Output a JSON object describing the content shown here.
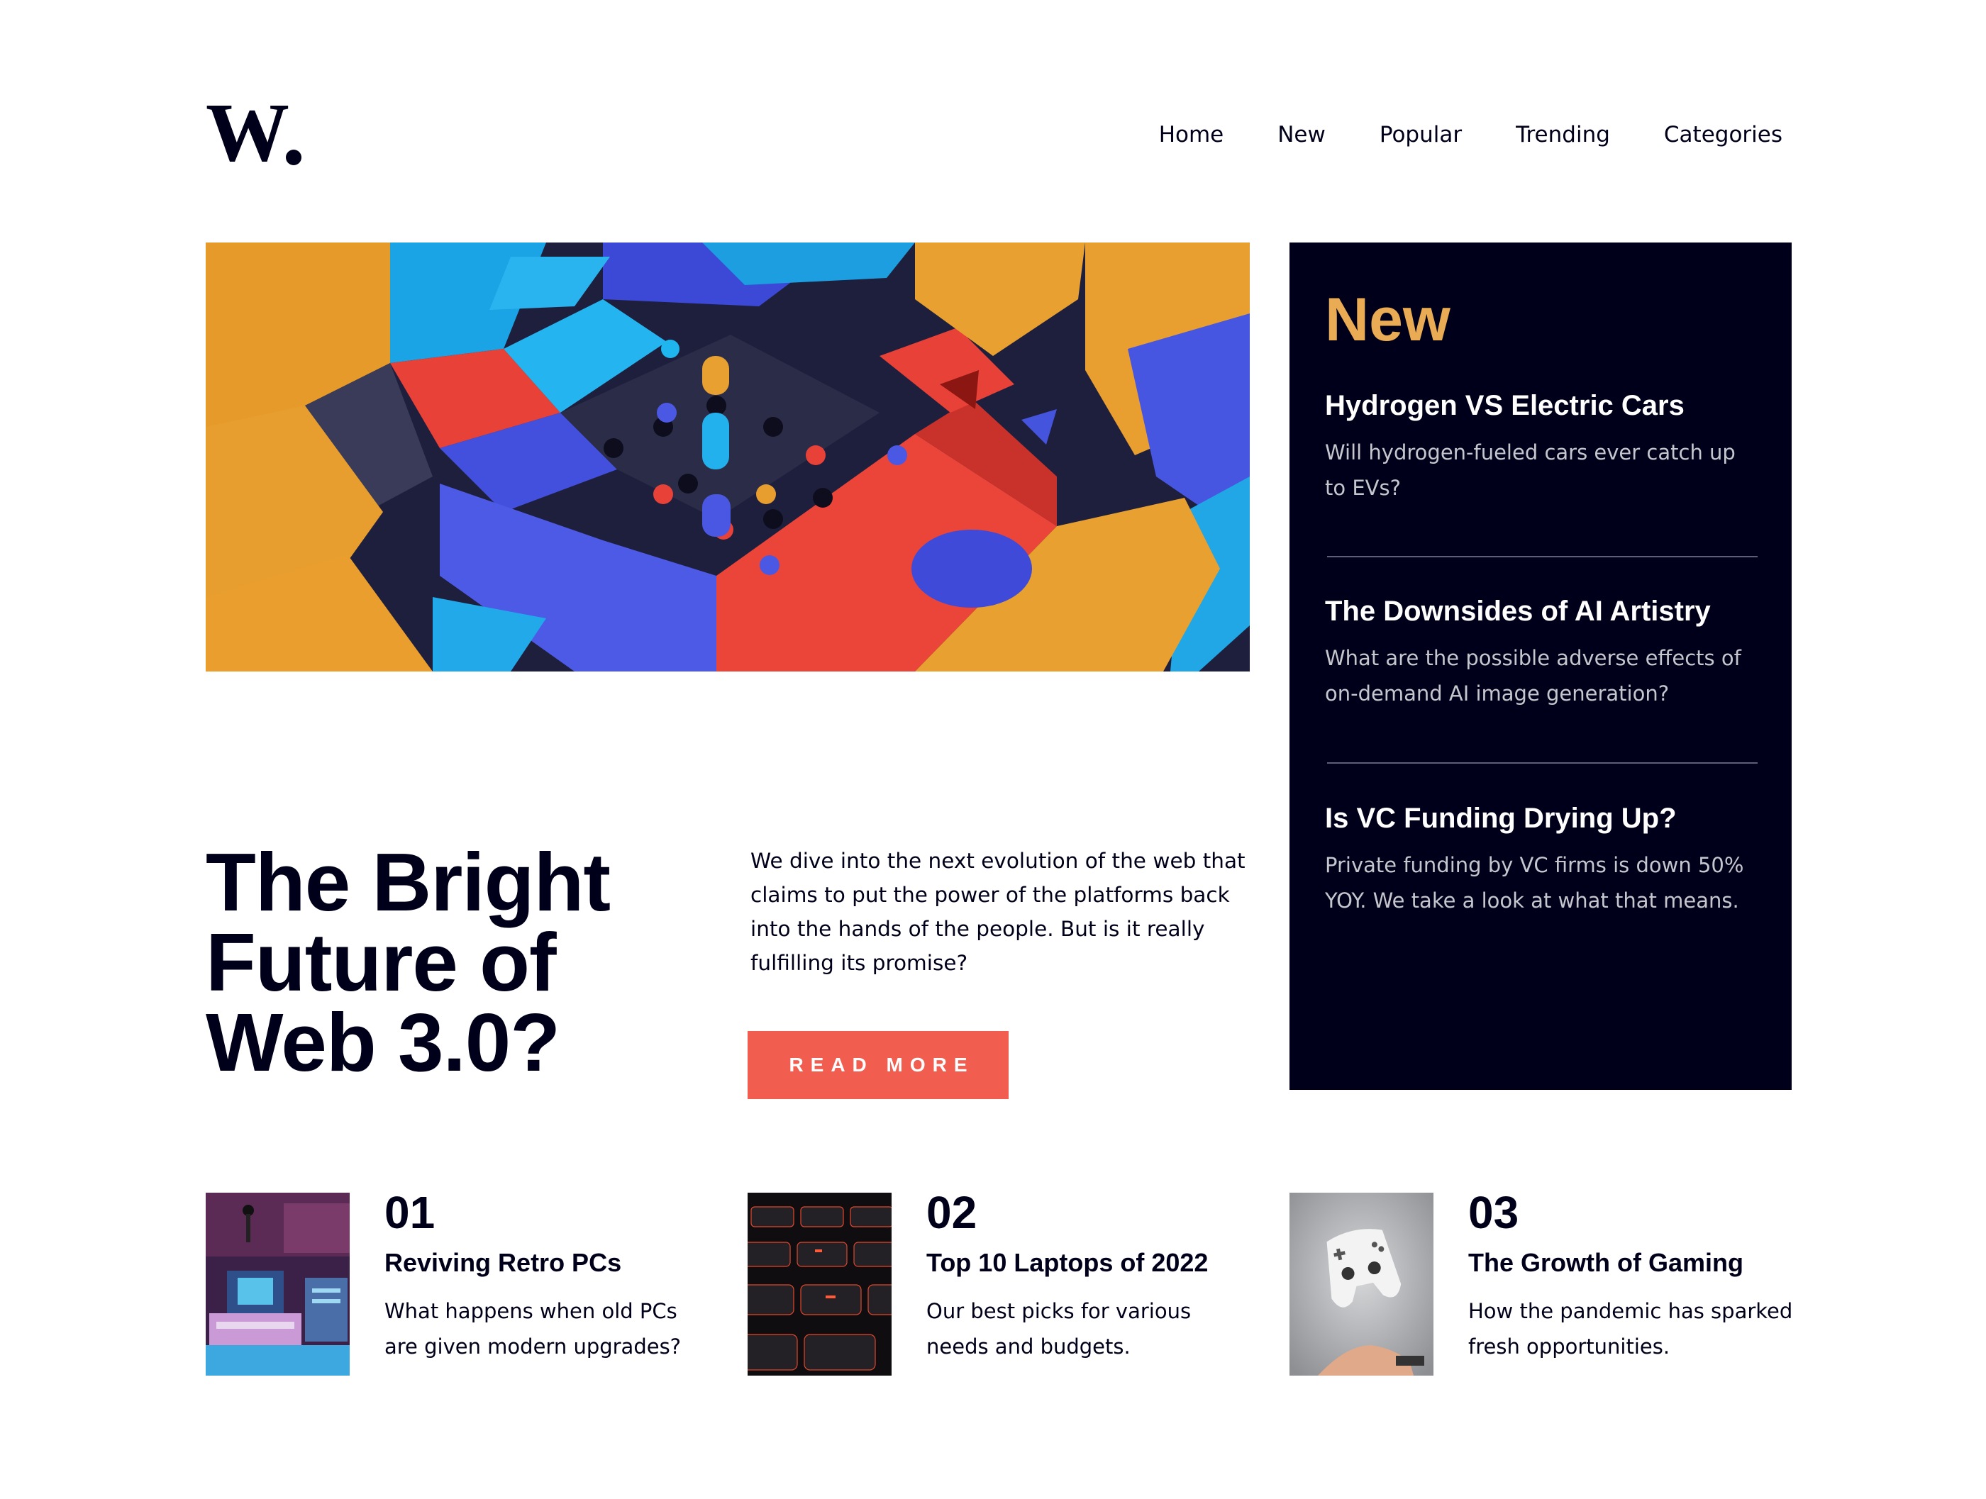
{
  "header": {
    "logo_letter": "W",
    "nav": [
      "Home",
      "New",
      "Popular",
      "Trending",
      "Categories"
    ]
  },
  "hero": {
    "image": "abstract-3d-blocks-image",
    "title": "The Bright Future of Web 3.0?",
    "description": "We dive into the next evolution of the web that claims to put the power of the platforms back into the hands of the people. But is it really fulfilling its promise?",
    "button": "READ MORE"
  },
  "new_panel": {
    "title": "New",
    "items": [
      {
        "title": "Hydrogen VS Electric Cars",
        "desc": "Will hydrogen-fueled cars ever catch up to EVs?"
      },
      {
        "title": "The Downsides of AI Artistry",
        "desc": "What are the possible adverse effects of on-demand AI image generation?"
      },
      {
        "title": "Is VC Funding Drying Up?",
        "desc": "Private funding by VC firms is down 50% YOY. We take a look at what that means."
      }
    ]
  },
  "cards": [
    {
      "num": "01",
      "title": "Reviving Retro PCs",
      "desc": "What happens when old PCs are given modern upgrades?",
      "image": "retro-pcs-image"
    },
    {
      "num": "02",
      "title": "Top 10 Laptops of 2022",
      "desc": "Our best picks for various needs and budgets.",
      "image": "keyboard-image"
    },
    {
      "num": "03",
      "title": "The Growth of Gaming",
      "desc": "How the pandemic has sparked fresh opportunities.",
      "image": "gamepad-image"
    }
  ],
  "colors": {
    "navy": "#00001a",
    "accent_orange": "#e9ab53",
    "accent_red": "#f15e50",
    "muted_text": "#c5c6ce"
  }
}
